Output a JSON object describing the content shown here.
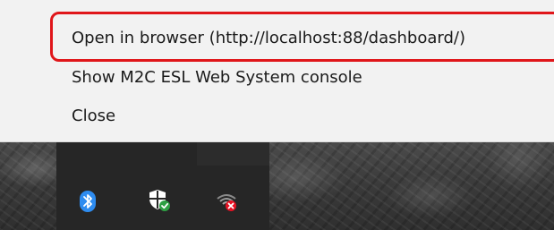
{
  "context_menu": {
    "items": [
      {
        "label": "Open in browser (http://localhost:88/dashboard/)",
        "highlighted": true
      },
      {
        "label": "Show M2C ESL Web System console",
        "highlighted": false
      },
      {
        "label": "Close",
        "highlighted": false
      }
    ],
    "highlight_color": "#e0161a"
  },
  "tray": {
    "icons": [
      {
        "name": "bluetooth-icon",
        "accent": "#2e8cf0"
      },
      {
        "name": "windows-security-shield-icon",
        "accent": "#2ea043"
      },
      {
        "name": "network-error-icon",
        "accent": "#e81123"
      }
    ]
  }
}
